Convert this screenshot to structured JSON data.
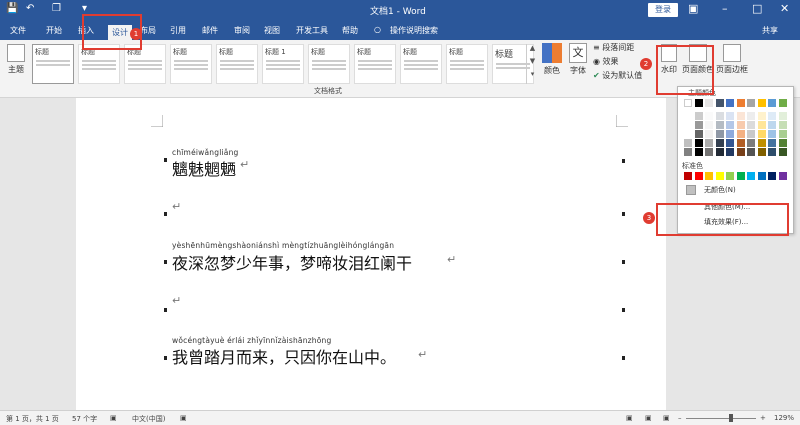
{
  "titlebar": {
    "title": "文档1 - Word",
    "login": "登录",
    "share": "共享"
  },
  "menu": {
    "tabs": [
      "文件",
      "开始",
      "插入",
      "设计",
      "布局",
      "引用",
      "邮件",
      "审阅",
      "视图",
      "开发工具",
      "帮助",
      "操作说明搜索"
    ],
    "active_tab": "设计"
  },
  "ribbon": {
    "theme_label": "主题",
    "style_heading": "标题",
    "style_heading2": "标题 1",
    "colors_label": "颜色",
    "fonts_label": "字体",
    "para_spacing_label": "段落间距",
    "effects_label": "效果",
    "set_default_label": "设为默认值",
    "watermark_label": "水印",
    "page_color_label": "页面颜色",
    "page_border_label": "页面边框",
    "group_label": "文档格式"
  },
  "badges": [
    "1",
    "2",
    "3"
  ],
  "document": {
    "line1_pinyin": "chīméiwǎngliǎng",
    "line1_text": "魑魅魍魉",
    "line2_pinyin": "yèshēnhūmèngshàoniánshì   mèngtízhuānglèihónglángān",
    "line2_text": "夜深忽梦少年事，梦啼妆泪红阑干",
    "line3_pinyin": "wǒcéngtàyuè érlái    zhǐyīnnǐzàishānzhōng",
    "line3_text": "我曾踏月而来，只因你在山中。"
  },
  "dropdown": {
    "theme_colors_label": "主题颜色",
    "standard_colors_label": "标准色",
    "no_color_label": "无颜色(N)",
    "other_colors_label": "其他颜色(M)...",
    "fill_effects_label": "填充效果(F)...",
    "standard_colors": [
      "#c00000",
      "#ff0000",
      "#ffc000",
      "#ffff00",
      "#92d050",
      "#00b050",
      "#00b0f0",
      "#0070c0",
      "#002060",
      "#7030a0"
    ],
    "theme_top": [
      "#ffffff",
      "#000000",
      "#e7e6e6",
      "#44546a",
      "#4472c4",
      "#ed7d31",
      "#a5a5a5",
      "#ffc000",
      "#5b9bd5",
      "#70ad47"
    ]
  },
  "statusbar": {
    "page": "第 1 页，共 1 页",
    "words": "57 个字",
    "lang": "中文(中国)",
    "zoom": "129%"
  },
  "colors": {
    "title_bar": "#2b579a",
    "highlight": "#e03c31"
  }
}
